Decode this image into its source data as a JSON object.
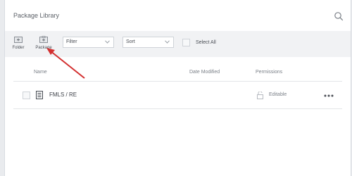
{
  "header": {
    "title": "Package Library",
    "search_icon": "search-icon"
  },
  "toolbar": {
    "folder_label": "Folder",
    "package_label": "Package",
    "filter_value": "Filter",
    "sort_value": "Sort",
    "select_all_label": "Select All"
  },
  "table": {
    "columns": [
      "Name",
      "Date Modified",
      "Permissions"
    ],
    "rows": [
      {
        "name": "FMLS / RE",
        "permission": "Editable",
        "icon": "package-icon"
      }
    ]
  },
  "colors": {
    "annotation_arrow": "#d32f2f",
    "toolbar_bg": "#f1f2f4"
  }
}
